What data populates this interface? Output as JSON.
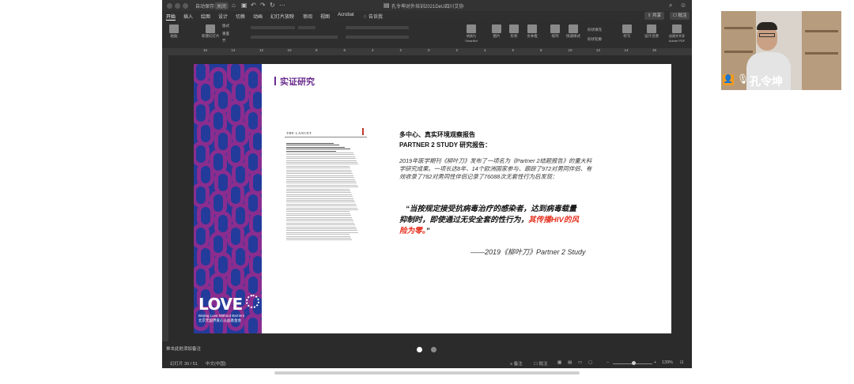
{
  "window": {
    "title": "孔令坤对外培训2021DeU四川艾协",
    "autosave_label": "自动保存",
    "autosave_state": "关闭"
  },
  "menu_tabs": [
    "开始",
    "插入",
    "绘图",
    "设计",
    "切换",
    "动画",
    "幻灯片放映",
    "审阅",
    "视图",
    "Acrobat",
    "告诉我"
  ],
  "toolbar": {
    "share_label": "共享",
    "comments_label": "批注"
  },
  "ribbon": {
    "paste": "粘贴",
    "new_slide": "新建幻灯片",
    "layout": "版式",
    "reset": "重置",
    "section": "节",
    "convert_smartart": "转换为SmartArt",
    "picture": "图片",
    "shape": "形状",
    "textbox": "文本框",
    "arrange": "排列",
    "quick_styles": "快速样式",
    "shape_fill": "形状填充",
    "shape_outline": "形状轮廓",
    "dictate": "听写",
    "designer": "设计灵感",
    "create_pdf": "创建并共享Adobe PDF",
    "editor": "编辑器"
  },
  "ruler_numbers": [
    "16",
    "14",
    "12",
    "10",
    "8",
    "6",
    "4",
    "2",
    "0",
    "2",
    "4",
    "6",
    "8",
    "10",
    "12",
    "14",
    "16"
  ],
  "slide": {
    "heading": "实证研究",
    "paper_journal": "THE LANCET",
    "subtitle1": "多中心、真实环境观察报告",
    "subtitle2": "PARTNER 2 STUDY 研究报告：",
    "paragraph": "2019年医学期刊《柳叶刀》发布了一项名为《Partner 2结题报告》的重大科学研究成果。一项长达8年、14个欧洲国家参与、跟踪了972对男同伴侣、有效收录了782对男同性伴侣记录了76088次无套性行为后发现：",
    "quote_line1": "“当按规定接受抗病毒治疗的感染者，达到病毒载量",
    "quote_line2_normal": "抑制时，即使通过无安全套的性行为，",
    "quote_line2_red": "其传播HIV的风",
    "quote_line3_red": "险为零。",
    "quote_line3_end": "”",
    "source": "——2019《柳叶刀》Partner 2 Study",
    "logo_text": "LOVE",
    "logo_sub1": "Beijing Love Without Barriers",
    "logo_sub2": "北京无国界爱心公益基金会"
  },
  "notes_placeholder": "单击此处添加备注",
  "status": {
    "slide_counter": "幻灯片 30 / 51",
    "language": "中文(中国)",
    "notes_btn": "备注",
    "comments_btn": "批注",
    "zoom": "139%"
  },
  "video": {
    "name": "孔令坤"
  },
  "colors": {
    "accent_purple": "#6a2b8e",
    "band_blue": "#233b9b",
    "band_magenta": "#8a2d8f",
    "quote_red": "#e6301e"
  }
}
